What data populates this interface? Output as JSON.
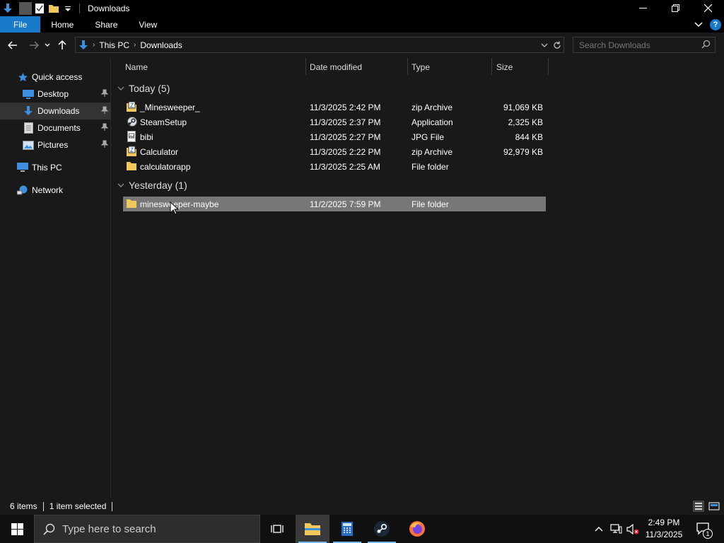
{
  "window": {
    "title": "Downloads"
  },
  "ribbon": {
    "tabs": [
      "File",
      "Home",
      "Share",
      "View"
    ]
  },
  "address": {
    "crumbs": [
      "This PC",
      "Downloads"
    ],
    "search_placeholder": "Search Downloads"
  },
  "sidebar": {
    "items": [
      {
        "label": "Quick access"
      },
      {
        "label": "Desktop"
      },
      {
        "label": "Downloads"
      },
      {
        "label": "Documents"
      },
      {
        "label": "Pictures"
      },
      {
        "label": "This PC"
      },
      {
        "label": "Network"
      }
    ]
  },
  "columns": [
    "Name",
    "Date modified",
    "Type",
    "Size"
  ],
  "groups": [
    {
      "label": "Today (5)"
    },
    {
      "label": "Yesterday (1)"
    }
  ],
  "files": [
    {
      "name": "_Minesweeper_",
      "date": "11/3/2025 2:42 PM",
      "type": "zip Archive",
      "size": "91,069 KB",
      "icon": "zip-icon"
    },
    {
      "name": "SteamSetup",
      "date": "11/3/2025 2:37 PM",
      "type": "Application",
      "size": "2,325 KB",
      "icon": "steam-setup-icon"
    },
    {
      "name": "bibi",
      "date": "11/3/2025 2:27 PM",
      "type": "JPG File",
      "size": "844 KB",
      "icon": "image-file-icon"
    },
    {
      "name": "Calculator",
      "date": "11/3/2025 2:22 PM",
      "type": "zip Archive",
      "size": "92,979 KB",
      "icon": "zip-icon"
    },
    {
      "name": "calculatorapp",
      "date": "11/3/2025 2:25 AM",
      "type": "File folder",
      "size": "",
      "icon": "folder-icon"
    },
    {
      "name": "minesweeper-maybe",
      "date": "11/2/2025 7:59 PM",
      "type": "File folder",
      "size": "",
      "icon": "folder-icon"
    }
  ],
  "status": {
    "items_count": "6 items",
    "selected": "1 item selected"
  },
  "taskbar": {
    "search_placeholder": "Type here to search",
    "time": "2:49 PM",
    "date": "11/3/2025",
    "notification_count": "1"
  },
  "colors": {
    "accent": "#1979ca",
    "folder": "#f3c85b",
    "selection": "#777777"
  }
}
